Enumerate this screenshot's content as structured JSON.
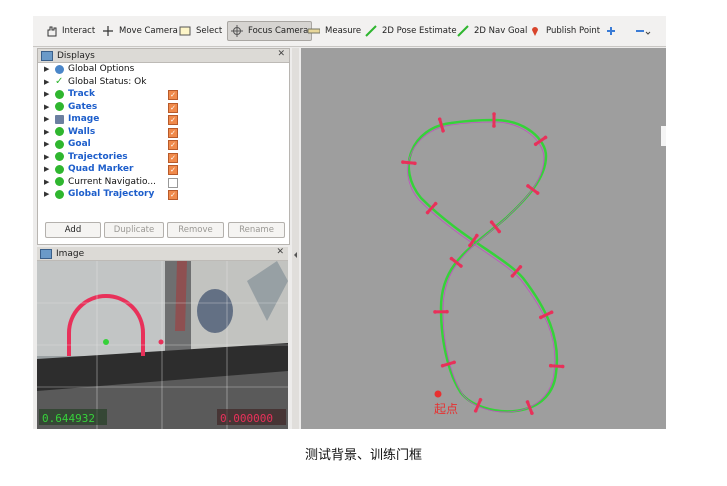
{
  "toolbar": {
    "interact": "Interact",
    "move_camera": "Move Camera",
    "select": "Select",
    "focus_camera": "Focus Camera",
    "measure": "Measure",
    "pose_estimate": "2D Pose Estimate",
    "nav_goal": "2D Nav Goal",
    "publish_point": "Publish Point"
  },
  "displays": {
    "title": "Displays",
    "items": [
      {
        "label": "Global Options",
        "icon": "globe-icon",
        "checked": null,
        "highlight": false
      },
      {
        "label": "Global Status: Ok",
        "icon": "check-icon",
        "checked": null,
        "highlight": false
      },
      {
        "label": "Track",
        "icon": "marker-icon",
        "checked": true,
        "highlight": true
      },
      {
        "label": "Gates",
        "icon": "marker-icon",
        "checked": true,
        "highlight": true
      },
      {
        "label": "Image",
        "icon": "image-icon",
        "checked": true,
        "highlight": true
      },
      {
        "label": "Walls",
        "icon": "marker-icon",
        "checked": true,
        "highlight": true
      },
      {
        "label": "Goal",
        "icon": "pose-icon",
        "checked": true,
        "highlight": true
      },
      {
        "label": "Trajectories",
        "icon": "pose-icon",
        "checked": true,
        "highlight": true
      },
      {
        "label": "Quad Marker",
        "icon": "marker-icon",
        "checked": true,
        "highlight": true
      },
      {
        "label": "Current Navigatio...",
        "icon": "pose-icon",
        "checked": false,
        "highlight": false
      },
      {
        "label": "Global Trajectory",
        "icon": "pose-icon",
        "checked": true,
        "highlight": true
      }
    ],
    "buttons": {
      "add": "Add",
      "duplicate": "Duplicate",
      "remove": "Remove",
      "rename": "Rename"
    }
  },
  "image_panel": {
    "title": "Image",
    "value_left": "0.644932",
    "value_right": "0.000000"
  },
  "view3d": {
    "start_label": "起点"
  },
  "caption": "测试背景、训练门框",
  "colors": {
    "track": "#36d13a",
    "gate": "#e8315a",
    "accent": "#f08a4b",
    "link": "#1d5ecb"
  }
}
